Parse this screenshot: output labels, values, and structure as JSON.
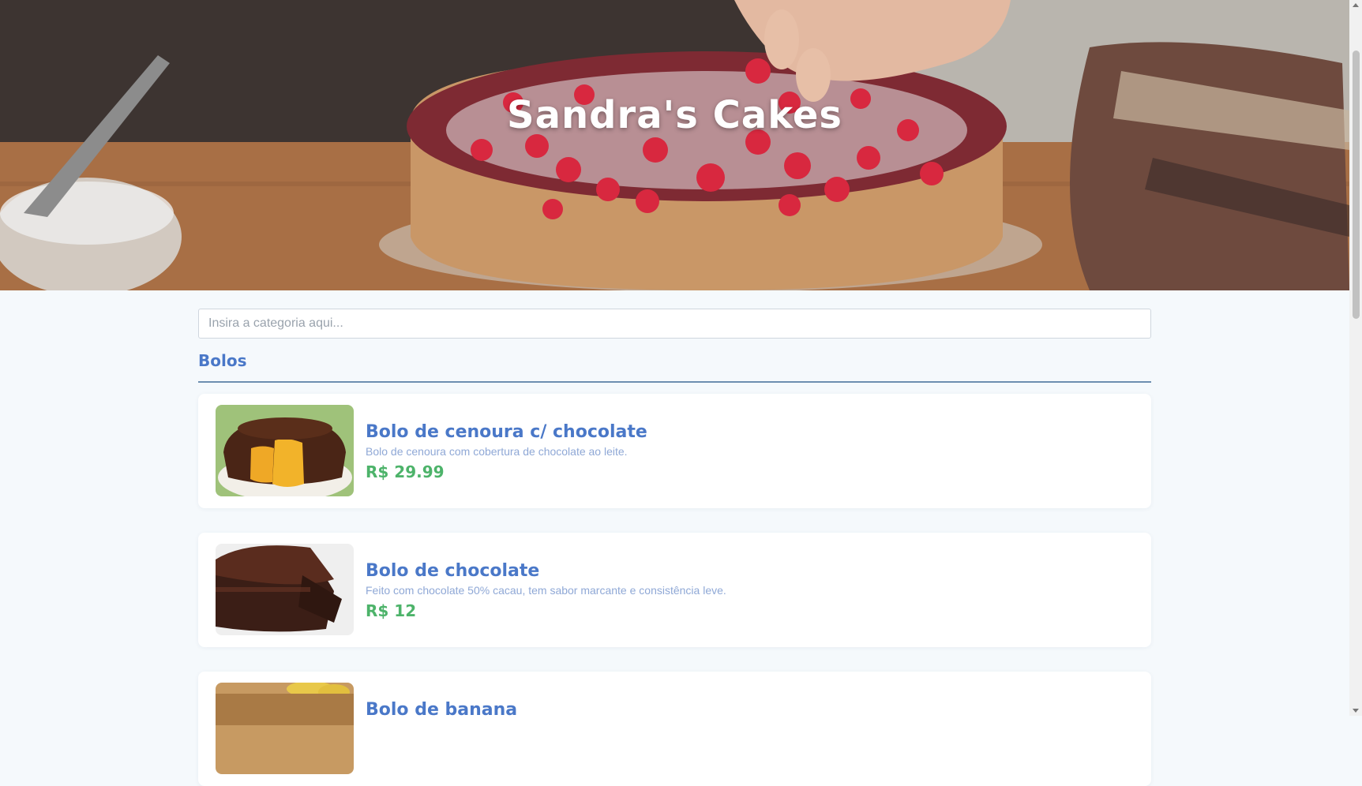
{
  "header": {
    "title": "Sandra's Cakes"
  },
  "search": {
    "placeholder": "Insira a categoria aqui..."
  },
  "category": {
    "name": "Bolos"
  },
  "products": [
    {
      "title": "Bolo de cenoura c/ chocolate",
      "description": "Bolo de cenoura com cobertura de chocolate ao leite.",
      "price": "R$ 29.99"
    },
    {
      "title": "Bolo de chocolate",
      "description": "Feito com chocolate 50% cacau, tem sabor marcante e consistência leve.",
      "price": "R$ 12"
    },
    {
      "title": "Bolo de banana",
      "description": "",
      "price": ""
    }
  ],
  "colors": {
    "accent": "#4a78c8",
    "price": "#4db36a",
    "background": "#f5f9fc"
  }
}
